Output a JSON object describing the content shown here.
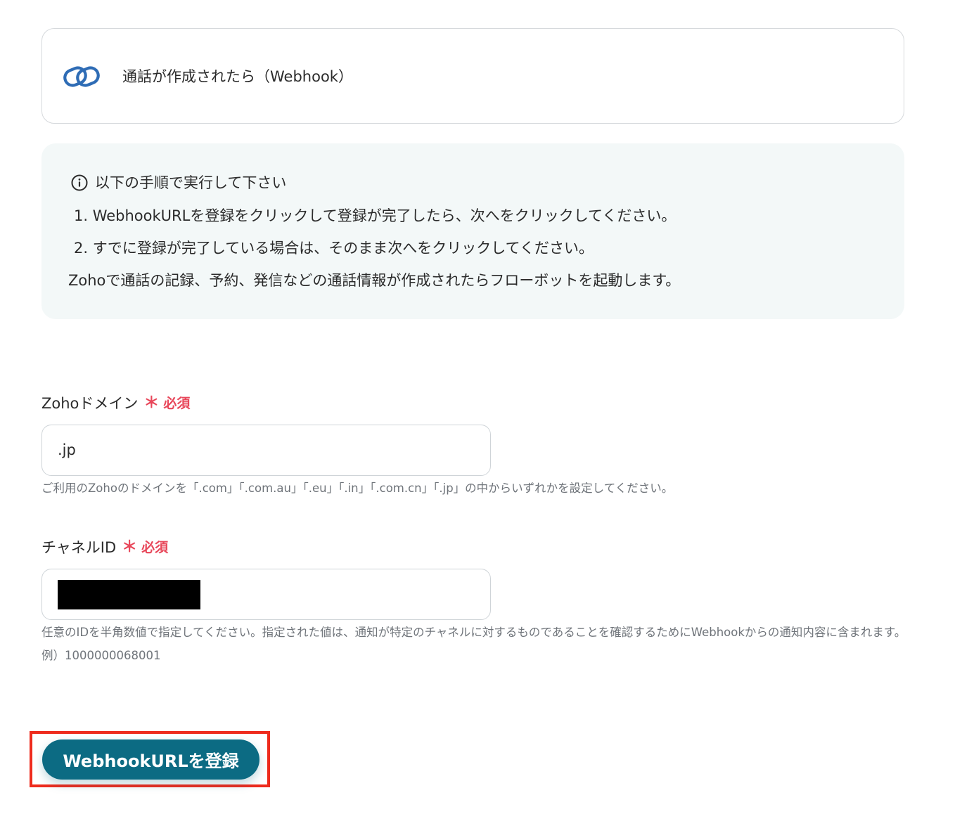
{
  "trigger": {
    "icon": "zoho-link-icon",
    "title": "通話が作成されたら（Webhook）"
  },
  "info": {
    "icon": "info-circle-icon",
    "heading": "以下の手順で実行して下さい",
    "steps": [
      "1. WebhookURLを登録をクリックして登録が完了したら、次へをクリックしてください。",
      "2. すでに登録が完了している場合は、そのまま次へをクリックしてください。"
    ],
    "description": "Zohoで通話の記録、予約、発信などの通話情報が作成されたらフローボットを起動します。"
  },
  "fields": {
    "domain": {
      "label": "Zohoドメイン",
      "required_mark": "＊",
      "required_text": "必須",
      "value": ".jp",
      "help": "ご利用のZohoのドメインを「.com」「.com.au」「.eu」「.in」「.com.cn」「.jp」の中からいずれかを設定してください。"
    },
    "channel_id": {
      "label": "チャネルID",
      "required_mark": "＊",
      "required_text": "必須",
      "help": "任意のIDを半角数値で指定してください。指定された値は、通知が特定のチャネルに対するものであることを確認するためにWebhookからの通知内容に含まれます。例）1000000068001"
    }
  },
  "actions": {
    "register_label": "WebhookURLを登録"
  },
  "colors": {
    "accent": "#0c6b83",
    "required": "#e8475a",
    "highlight": "#ee2b1d",
    "info_bg": "#f3f8f8"
  }
}
